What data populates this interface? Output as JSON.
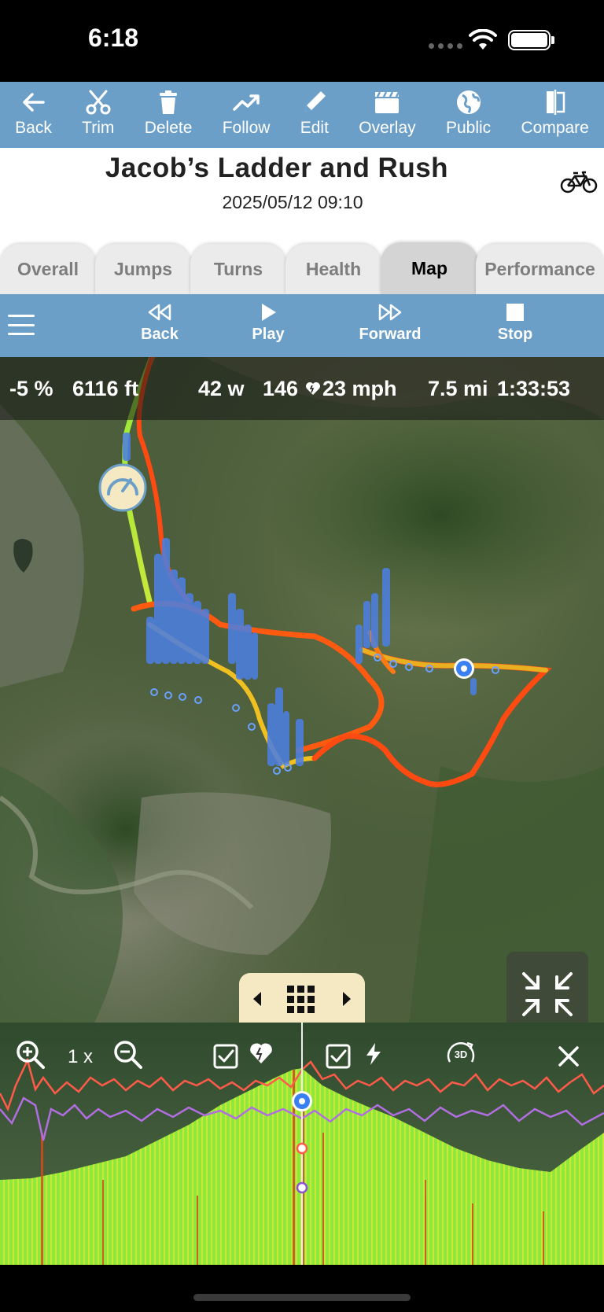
{
  "status_bar": {
    "time": "6:18"
  },
  "toolbar": {
    "items": [
      {
        "label": "Back",
        "icon": "arrow-left-icon"
      },
      {
        "label": "Trim",
        "icon": "scissors-icon"
      },
      {
        "label": "Delete",
        "icon": "trash-icon"
      },
      {
        "label": "Follow",
        "icon": "trend-icon"
      },
      {
        "label": "Edit",
        "icon": "pencil-icon"
      },
      {
        "label": "Overlay",
        "icon": "clapperboard-icon"
      },
      {
        "label": "Public",
        "icon": "globe-icon"
      },
      {
        "label": "Compare",
        "icon": "compare-icon"
      }
    ]
  },
  "ride": {
    "title": "Jacob’s Ladder and Rush",
    "datetime": "2025/05/12 09:10",
    "activity_icon": "bicycle-icon"
  },
  "tabs": {
    "items": [
      "Overall",
      "Jumps",
      "Turns",
      "Health",
      "Map",
      "Performance"
    ],
    "active": "Map"
  },
  "playback": {
    "back_label": "Back",
    "play_label": "Play",
    "forward_label": "Forward",
    "stop_label": "Stop"
  },
  "readout": {
    "grade": "-5 %",
    "elevation": "6116 ft",
    "power": "42 w",
    "heart_rate": "146",
    "speed": "23 mph",
    "distance": "7.5 mi",
    "duration": "1:33:53"
  },
  "chart_controls": {
    "zoom_level": "1 x",
    "heart_checked": true,
    "power_checked": true
  },
  "colors": {
    "toolbar": "#6b9fc8",
    "tab_active": "#d4d4d4",
    "tab_inactive": "#ebebeb",
    "track_fast": "#ff4a12",
    "track_slow": "#8fe83a",
    "jump_bars": "#4d7fe0",
    "heart_line": "#ff5a4a",
    "power_line": "#b06ee0",
    "elevation_fill": "#8fe83a"
  }
}
